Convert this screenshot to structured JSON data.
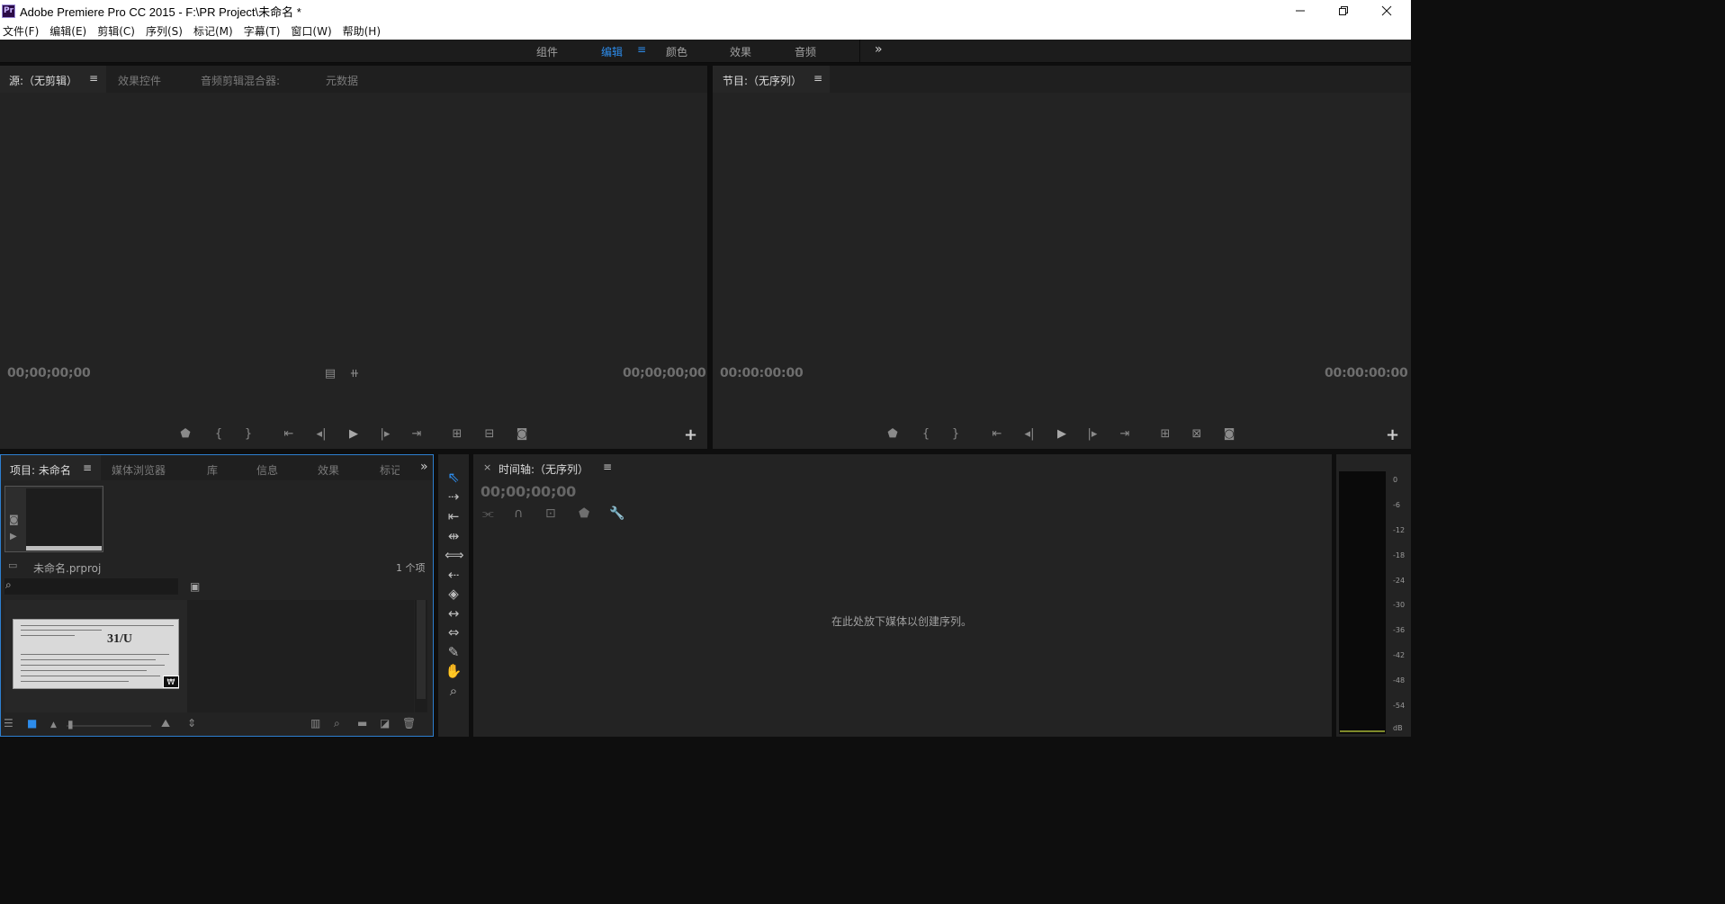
{
  "window": {
    "app_icon": "Pr",
    "title": "Adobe Premiere Pro CC 2015 - F:\\PR Project\\未命名 *",
    "minimize_icon": "minimize-icon",
    "restore_icon": "restore-icon",
    "close_icon": "close-icon"
  },
  "menu": [
    "文件(F)",
    "编辑(E)",
    "剪辑(C)",
    "序列(S)",
    "标记(M)",
    "字幕(T)",
    "窗口(W)",
    "帮助(H)"
  ],
  "workspace": {
    "tabs": [
      "组件",
      "编辑",
      "颜色",
      "效果",
      "音频"
    ],
    "active": "编辑",
    "menu_glyph": "≡",
    "more": "»"
  },
  "source_monitor": {
    "tabs": [
      "源:（无剪辑）",
      "效果控件",
      "音频剪辑混合器:",
      "元数据"
    ],
    "menu_glyph": "≡",
    "timecode_left": "00;00;00;00",
    "timecode_right": "00;00;00;00",
    "add": "+"
  },
  "program_monitor": {
    "title": "节目:（无序列）",
    "menu_glyph": "≡",
    "timecode_left": "00:00:00:00",
    "timecode_right": "00:00:00:00",
    "add": "+"
  },
  "project": {
    "tabs": [
      "项目: 未命名",
      "媒体浏览器",
      "库",
      "信息",
      "效果",
      "标记"
    ],
    "menu_glyph": "≡",
    "more": "»",
    "file_name": "未命名.prproj",
    "item_count": "1 个项",
    "search_placeholder": "",
    "thumbnail_text": "31/U",
    "thumbnail_badge": "₩"
  },
  "timeline": {
    "close": "×",
    "title": "时间轴:（无序列）",
    "menu_glyph": "≡",
    "timecode": "00;00;00;00",
    "drop_hint": "在此处放下媒体以创建序列。"
  },
  "audio_meter": {
    "ticks": [
      "0",
      "-6",
      "-12",
      "-18",
      "-24",
      "-30",
      "-36",
      "-42",
      "-48",
      "-54",
      "dB"
    ],
    "colors": {
      "level": "#7f8a2a"
    }
  },
  "colors": {
    "accent": "#2d8ceb",
    "panel": "#232323",
    "header": "#1f1f1f"
  }
}
